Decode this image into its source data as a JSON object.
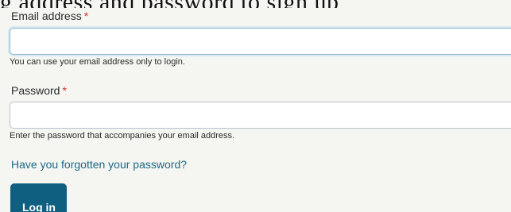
{
  "header": {
    "clipped_text": "g  address and password to sign up"
  },
  "form": {
    "email": {
      "label": "Email address",
      "required_mark": "*",
      "value": "",
      "help": "You can use your email address only to login."
    },
    "password": {
      "label": "Password",
      "required_mark": "*",
      "value": "",
      "help": "Enter the password that accompanies your email address."
    },
    "forgot_link": "Have you forgotten your password?",
    "submit_label": "Log in"
  },
  "colors": {
    "background": "#f5f5f2",
    "link": "#1a6a86",
    "button": "#0f5f80",
    "required": "#d0312d"
  }
}
